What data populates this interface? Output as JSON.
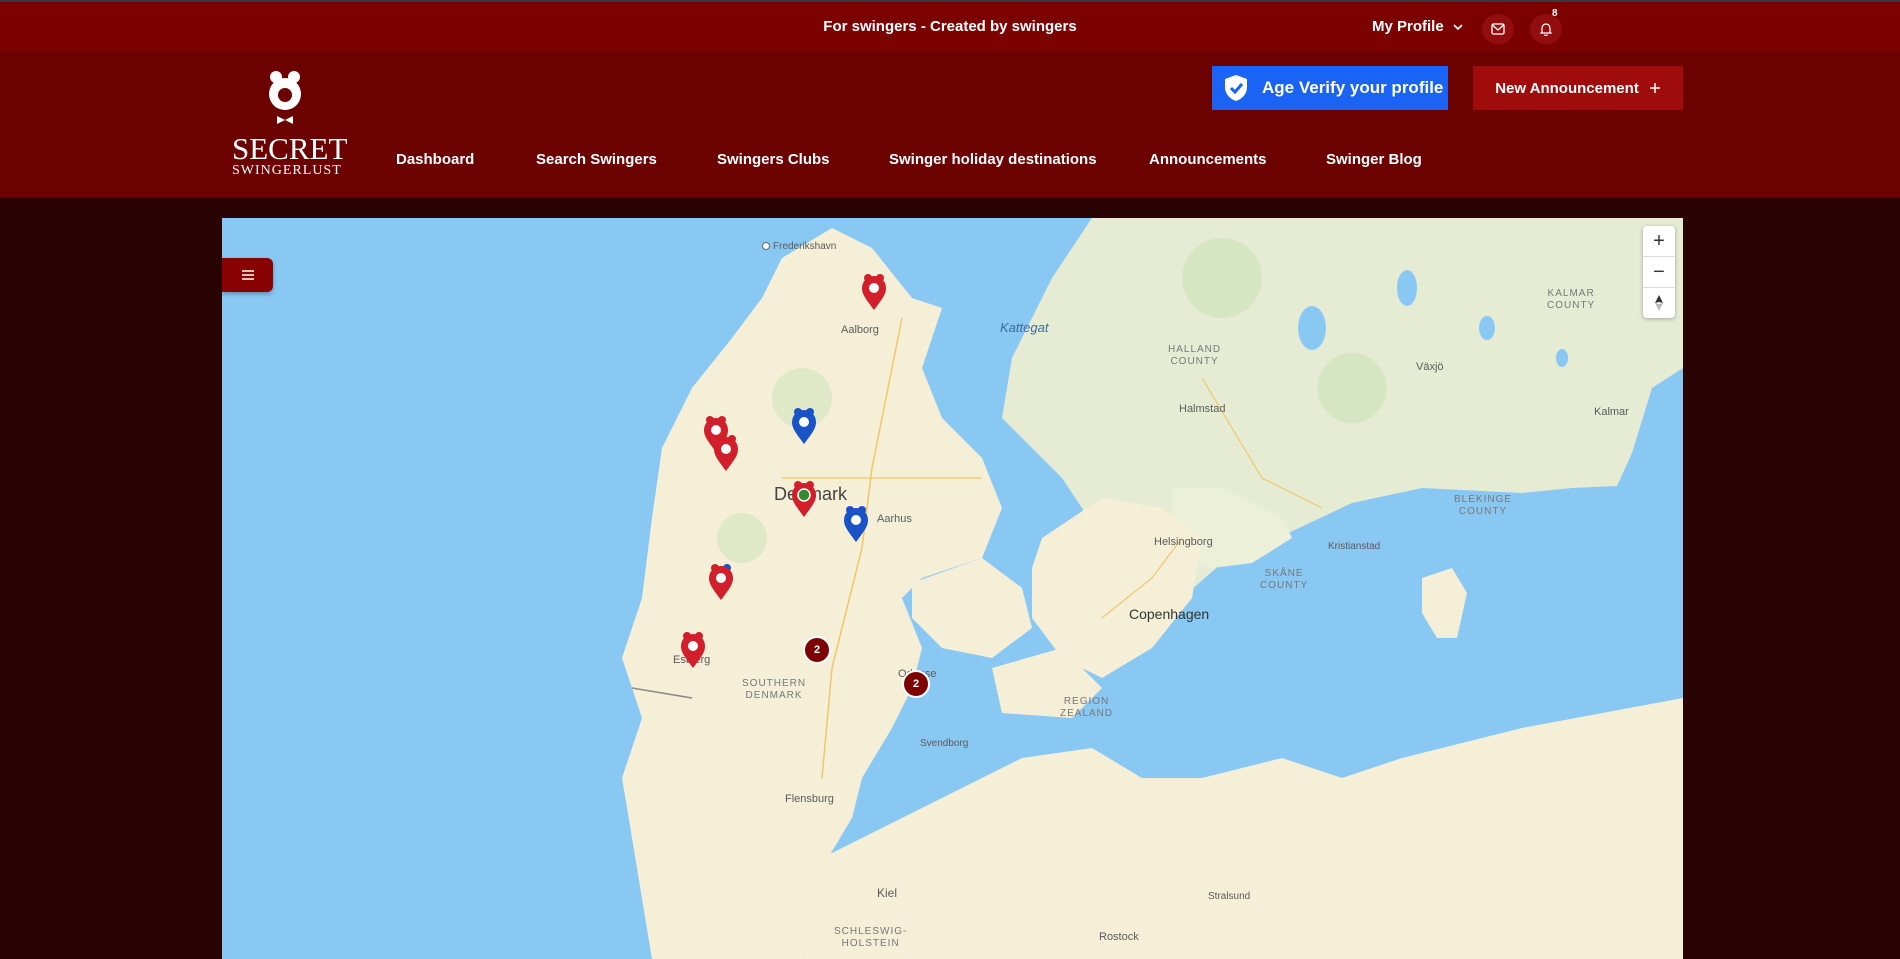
{
  "topbar": {
    "tagline": "For swingers - Created by swingers",
    "profile_label": "My Profile",
    "notification_count": "8"
  },
  "logo": {
    "line1": "SECRET",
    "line2": "SWINGERLUST"
  },
  "nav": [
    {
      "label": "Dashboard"
    },
    {
      "label": "Search Swingers"
    },
    {
      "label": "Swingers Clubs"
    },
    {
      "label": "Swinger holiday destinations"
    },
    {
      "label": "Announcements"
    },
    {
      "label": "Swinger Blog"
    }
  ],
  "buttons": {
    "age_verify": "Age Verify your profile",
    "new_announcement": "New Announcement"
  },
  "map": {
    "places": [
      {
        "name": "Frederikshavn"
      },
      {
        "name": "Aalborg"
      },
      {
        "name": "Kattegat"
      },
      {
        "name": "Denmark"
      },
      {
        "name": "Aarhus"
      },
      {
        "name": "Esbjerg"
      },
      {
        "name": "Odense"
      },
      {
        "name": "Svendborg"
      },
      {
        "name": "Flensburg"
      },
      {
        "name": "Kiel"
      },
      {
        "name": "Copenhagen"
      },
      {
        "name": "Helsingborg"
      },
      {
        "name": "Halmstad"
      },
      {
        "name": "Växjö"
      },
      {
        "name": "Kalmar"
      },
      {
        "name": "Kristianstad"
      },
      {
        "name": "Stralsund"
      },
      {
        "name": "Rostock"
      }
    ],
    "regions": [
      {
        "name": "HALLAND\nCOUNTY"
      },
      {
        "name": "KALMAR\nCOUNTY"
      },
      {
        "name": "BLEKINGE\nCOUNTY"
      },
      {
        "name": "SKÅNE\nCOUNTY"
      },
      {
        "name": "SOUTHERN\nDENMARK"
      },
      {
        "name": "REGION\nZEALAND"
      },
      {
        "name": "SCHLESWIG-\nHOLSTEIN"
      }
    ],
    "clusters": [
      {
        "count": "2"
      },
      {
        "count": "2"
      }
    ],
    "colors": {
      "water": "#8ac8f4",
      "land_dk": "#f4efd6",
      "land_se": "#e6ecd3",
      "pin_red": "#d11f2c",
      "pin_blue": "#1a52c8",
      "pin_green": "#2e8b2e"
    }
  }
}
